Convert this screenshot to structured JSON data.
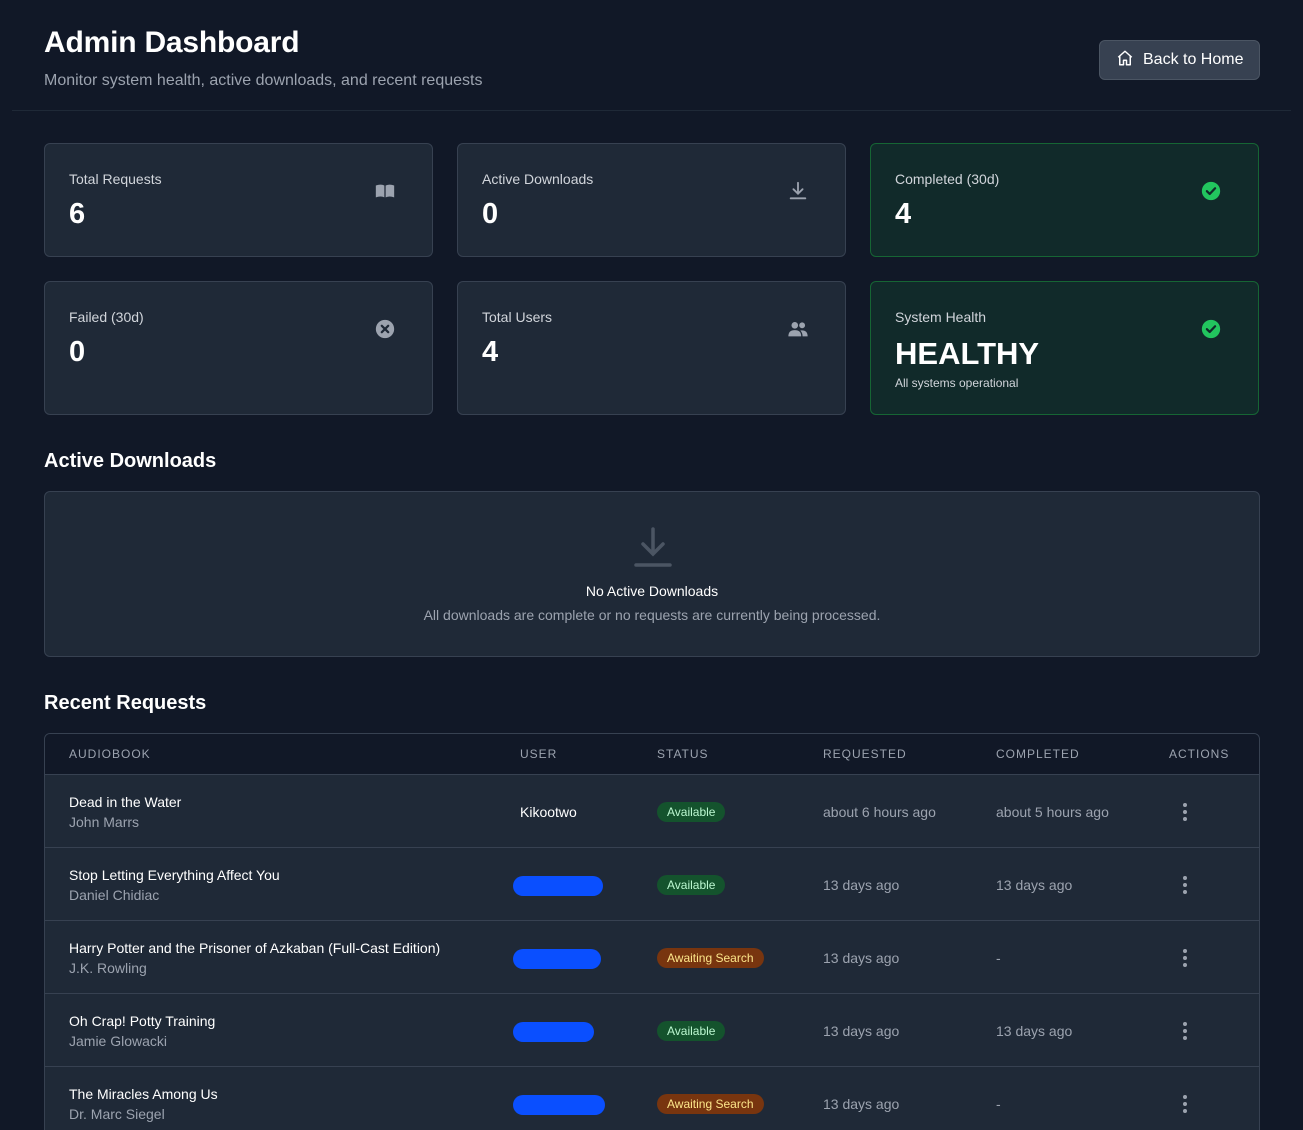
{
  "header": {
    "title": "Admin Dashboard",
    "subtitle": "Monitor system health, active downloads, and recent requests",
    "back_label": "Back to Home"
  },
  "stats": {
    "total_requests": {
      "label": "Total Requests",
      "value": "6",
      "icon": "book-icon"
    },
    "active_downloads": {
      "label": "Active Downloads",
      "value": "0",
      "icon": "download-icon"
    },
    "completed": {
      "label": "Completed (30d)",
      "value": "4",
      "icon": "check-circle-icon"
    },
    "failed": {
      "label": "Failed (30d)",
      "value": "0",
      "icon": "x-circle-icon"
    },
    "total_users": {
      "label": "Total Users",
      "value": "4",
      "icon": "users-icon"
    },
    "system_health": {
      "label": "System Health",
      "value": "HEALTHY",
      "note": "All systems operational",
      "icon": "check-circle-icon"
    }
  },
  "colors": {
    "background": "#111827",
    "card": "#1f2937",
    "success": "#22c55e",
    "available_badge": "#14532d",
    "awaiting_badge": "#78350f",
    "redaction": "#0a4fff"
  },
  "active_downloads": {
    "title": "Active Downloads",
    "empty_title": "No Active Downloads",
    "empty_text": "All downloads are complete or no requests are currently being processed."
  },
  "recent_requests": {
    "title": "Recent Requests",
    "columns": [
      "Audiobook",
      "User",
      "Status",
      "Requested",
      "Completed",
      "Actions"
    ],
    "rows": [
      {
        "title": "Dead in the Water",
        "author": "John Marrs",
        "user": "Kikootwo",
        "status": "Available",
        "requested": "about 6 hours ago",
        "completed": "about 5 hours ago"
      },
      {
        "title": "Stop Letting Everything Affect You",
        "author": "Daniel Chidiac",
        "user": "",
        "status": "Available",
        "requested": "13 days ago",
        "completed": "13 days ago"
      },
      {
        "title": "Harry Potter and the Prisoner of Azkaban (Full-Cast Edition)",
        "author": "J.K. Rowling",
        "user": "",
        "status": "Awaiting Search",
        "requested": "13 days ago",
        "completed": "-"
      },
      {
        "title": "Oh Crap! Potty Training",
        "author": "Jamie Glowacki",
        "user": "",
        "status": "Available",
        "requested": "13 days ago",
        "completed": "13 days ago"
      },
      {
        "title": "The Miracles Among Us",
        "author": "Dr. Marc Siegel",
        "user": "",
        "status": "Awaiting Search",
        "requested": "13 days ago",
        "completed": "-"
      }
    ]
  }
}
